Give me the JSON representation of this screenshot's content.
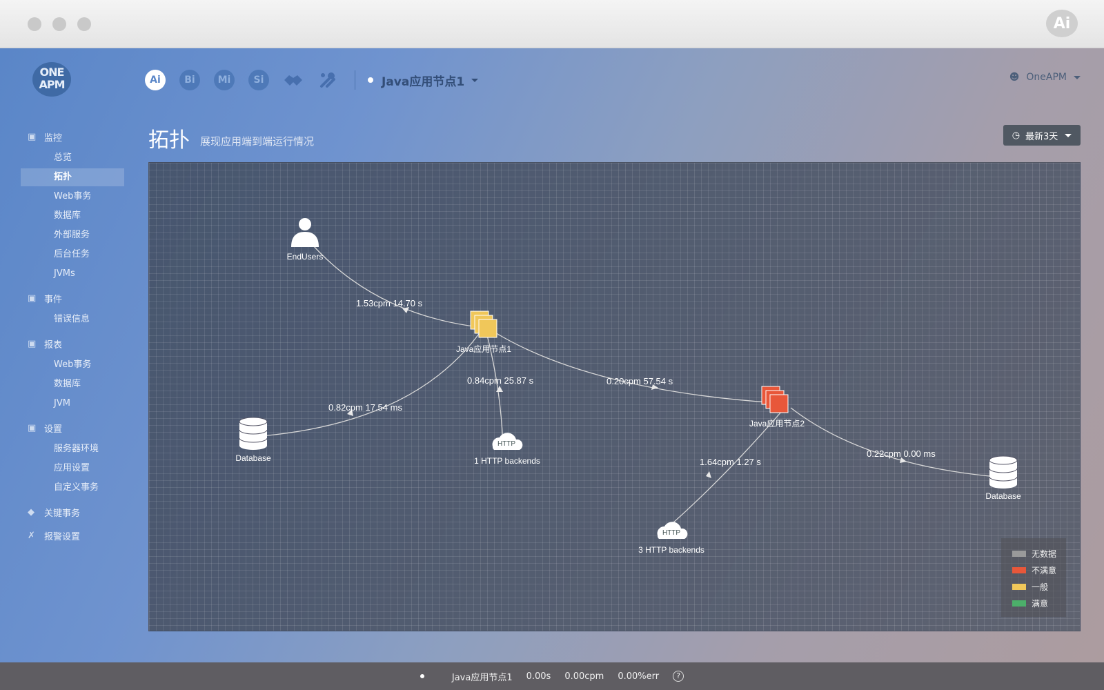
{
  "window": {
    "corner_badge": "Ai"
  },
  "logo": {
    "line1": "ONE",
    "line2": "APM"
  },
  "topnav": {
    "products": [
      {
        "label": "Ai",
        "icon": "ai-icon"
      },
      {
        "label": "Bi",
        "icon": "bi-icon"
      },
      {
        "label": "Mi",
        "icon": "mi-icon"
      },
      {
        "label": "Si",
        "icon": "si-icon"
      }
    ],
    "app_selector": "Java应用节点1",
    "user": "OneAPM"
  },
  "sidebar": {
    "sections": [
      {
        "title": "监控",
        "items": [
          "总览",
          "拓扑",
          "Web事务",
          "数据库",
          "外部服务",
          "后台任务",
          "JVMs"
        ]
      },
      {
        "title": "事件",
        "items": [
          "错误信息"
        ]
      },
      {
        "title": "报表",
        "items": [
          "Web事务",
          "数据库",
          "JVM"
        ]
      },
      {
        "title": "设置",
        "items": [
          "服务器环境",
          "应用设置",
          "自定义事务"
        ]
      },
      {
        "title": "关键事务",
        "items": []
      },
      {
        "title": "报警设置",
        "items": []
      }
    ],
    "active_item": "拓扑"
  },
  "header": {
    "title": "拓扑",
    "subtitle": "展现应用端到端运行情况",
    "time_range": "最新3天"
  },
  "topology": {
    "nodes": [
      {
        "id": "endusers",
        "type": "user",
        "label": "EndUsers",
        "status": "none"
      },
      {
        "id": "java1",
        "type": "app",
        "label": "Java应用节点1",
        "status": "一般"
      },
      {
        "id": "java2",
        "type": "app",
        "label": "Java应用节点2",
        "status": "不满意"
      },
      {
        "id": "db1",
        "type": "database",
        "label": "Database",
        "status": "none"
      },
      {
        "id": "http1",
        "type": "http",
        "label": "1 HTTP backends",
        "icon_text": "HTTP",
        "status": "none"
      },
      {
        "id": "http3",
        "type": "http",
        "label": "3 HTTP backends",
        "icon_text": "HTTP",
        "status": "none"
      },
      {
        "id": "db2",
        "type": "database",
        "label": "Database",
        "status": "none"
      }
    ],
    "edges": [
      {
        "from": "endusers",
        "to": "java1",
        "label": "1.53cpm 14.70 s"
      },
      {
        "from": "java1",
        "to": "db1",
        "label": "0.82cpm 17.54 ms"
      },
      {
        "from": "java1",
        "to": "http1",
        "label": "0.84cpm 25.87 s"
      },
      {
        "from": "java1",
        "to": "java2",
        "label": "0.20cpm 57.54 s"
      },
      {
        "from": "java2",
        "to": "http3",
        "label": "1.64cpm 1.27 s"
      },
      {
        "from": "java2",
        "to": "db2",
        "label": "0.22cpm 0.00 ms"
      }
    ]
  },
  "legend": [
    {
      "label": "无数据",
      "color": "#9a9a9a"
    },
    {
      "label": "不满意",
      "color": "#e8573a"
    },
    {
      "label": "一般",
      "color": "#f0c75a"
    },
    {
      "label": "满意",
      "color": "#4caf6a"
    }
  ],
  "statusbar": {
    "app": "Java应用节点1",
    "response": "0.00s",
    "throughput": "0.00cpm",
    "error": "0.00%err",
    "help": "?"
  }
}
